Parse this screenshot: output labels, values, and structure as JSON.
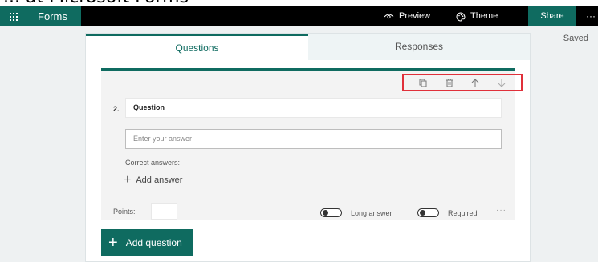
{
  "page_heading": "... at Microsoft Forms",
  "topbar": {
    "app_name": "Forms",
    "preview_label": "Preview",
    "theme_label": "Theme",
    "share_label": "Share",
    "more_label": "···"
  },
  "status": {
    "saved": "Saved"
  },
  "tabs": [
    {
      "label": "Questions",
      "active": true
    },
    {
      "label": "Responses",
      "active": false
    }
  ],
  "question": {
    "number": "2.",
    "title": "Question",
    "answer_placeholder": "Enter your answer",
    "correct_answers_label": "Correct answers:",
    "add_answer_label": "Add answer",
    "points_label": "Points:",
    "points_value": "",
    "long_answer_label": "Long answer",
    "long_answer_on": false,
    "required_label": "Required",
    "required_on": false,
    "more_label": "···",
    "toolbar_icons": [
      "copy-icon",
      "delete-icon",
      "move-up-icon",
      "move-down-icon"
    ]
  },
  "add_question_label": "Add question",
  "colors": {
    "accent": "#0f6b60",
    "highlight": "#e0303a",
    "topbar": "#000000"
  }
}
